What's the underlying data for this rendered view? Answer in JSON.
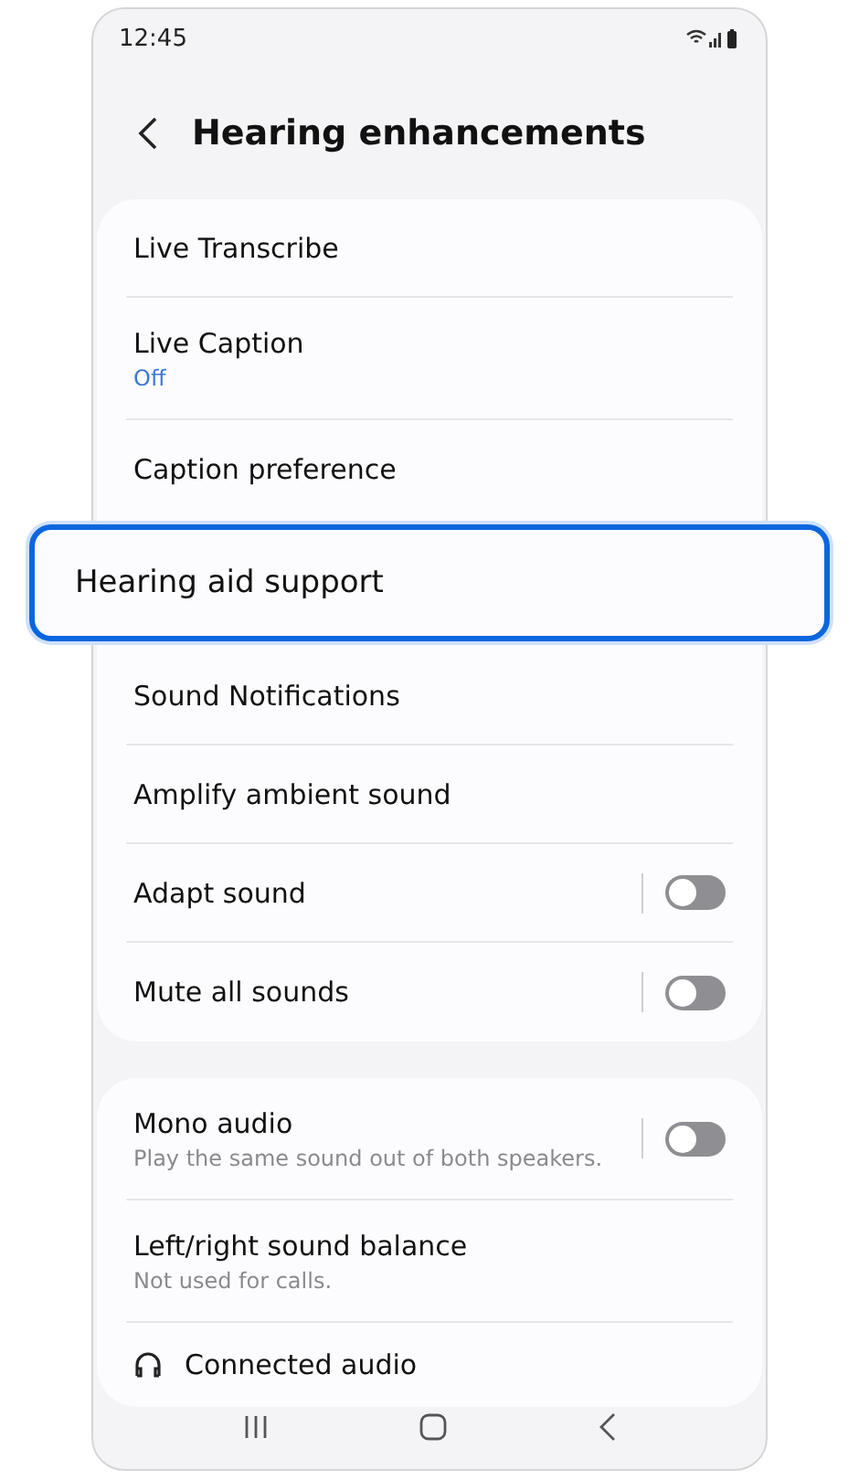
{
  "status_bar": {
    "time": "12:45"
  },
  "header": {
    "title": "Hearing enhancements"
  },
  "groups": [
    {
      "items": [
        {
          "kind": "item",
          "title": "Live Transcribe",
          "highlighted": false
        },
        {
          "kind": "item",
          "title": "Live Caption",
          "subtitle": {
            "text": "Off",
            "kind": "status"
          },
          "highlighted": false
        },
        {
          "kind": "item",
          "title": "Caption preference",
          "highlighted": false
        },
        {
          "kind": "item",
          "title": "Hearing aid support",
          "highlighted": true
        },
        {
          "kind": "item",
          "title": "Sound Notifications",
          "highlighted": false
        },
        {
          "kind": "item",
          "title": "Amplify ambient sound",
          "highlighted": false
        },
        {
          "kind": "item",
          "title": "Adapt sound",
          "toggle": {
            "on": false
          },
          "highlighted": false
        },
        {
          "kind": "item",
          "title": "Mute all sounds",
          "toggle": {
            "on": false
          },
          "highlighted": false
        }
      ]
    },
    {
      "items": [
        {
          "kind": "item",
          "title": "Mono audio",
          "subtitle": {
            "text": "Play the same sound out of both speakers.",
            "kind": "description"
          },
          "toggle": {
            "on": false
          },
          "highlighted": false
        },
        {
          "kind": "item",
          "title": "Left/right sound balance",
          "subtitle": {
            "text": "Not used for calls.",
            "kind": "description"
          },
          "highlighted": false
        },
        {
          "kind": "header",
          "title": "Connected audio",
          "highlighted": false
        }
      ]
    }
  ]
}
